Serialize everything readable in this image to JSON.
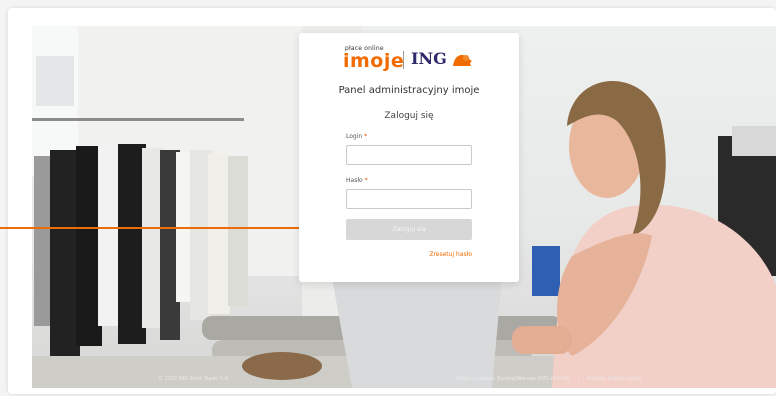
{
  "brand": {
    "small_text": "płace online",
    "product": "imoje",
    "bank": "ING"
  },
  "panel": {
    "title": "Panel administracyjny imoje",
    "subtitle": "Zaloguj się"
  },
  "form": {
    "login_label": "Login",
    "password_label": "Hasło",
    "required_mark": "*",
    "login_value": "",
    "password_value": "",
    "submit_label": "Zaloguj się",
    "reset_link": "Zresetuj hasło"
  },
  "footer": {
    "copyright": "© 2022 ING Bank Śląski S.A.",
    "timezone": "Strefa czasowa: Europe/Warsaw (UTC+01:00)",
    "separator": "|",
    "privacy_link": "Polityka plików cookie"
  },
  "colors": {
    "accent": "#f06c00",
    "ing_navy": "#2e2a6b",
    "arrow": "#ef6a0a",
    "button_disabled": "#d7d7d7"
  }
}
